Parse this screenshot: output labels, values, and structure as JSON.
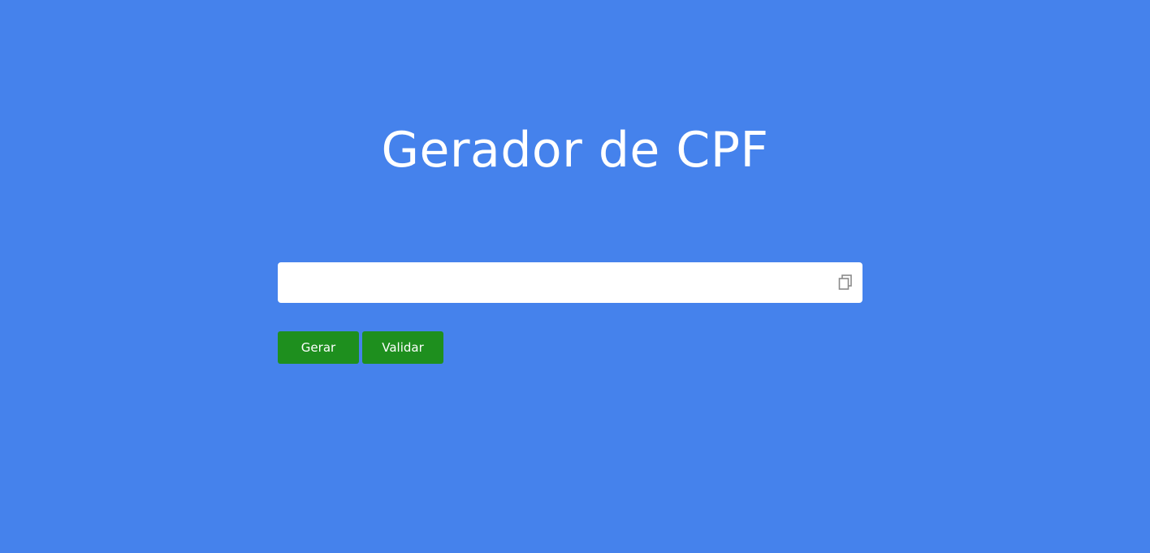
{
  "header": {
    "title": "Gerador de CPF"
  },
  "cpf_field": {
    "value": "",
    "placeholder": "",
    "copy_icon": "copy-icon"
  },
  "actions": {
    "generate_label": "Gerar",
    "validate_label": "Validar"
  },
  "colors": {
    "background": "#4582EC",
    "button": "#1E8F1E",
    "field": "#FFFFFF",
    "icon": "#8A8A8A"
  }
}
